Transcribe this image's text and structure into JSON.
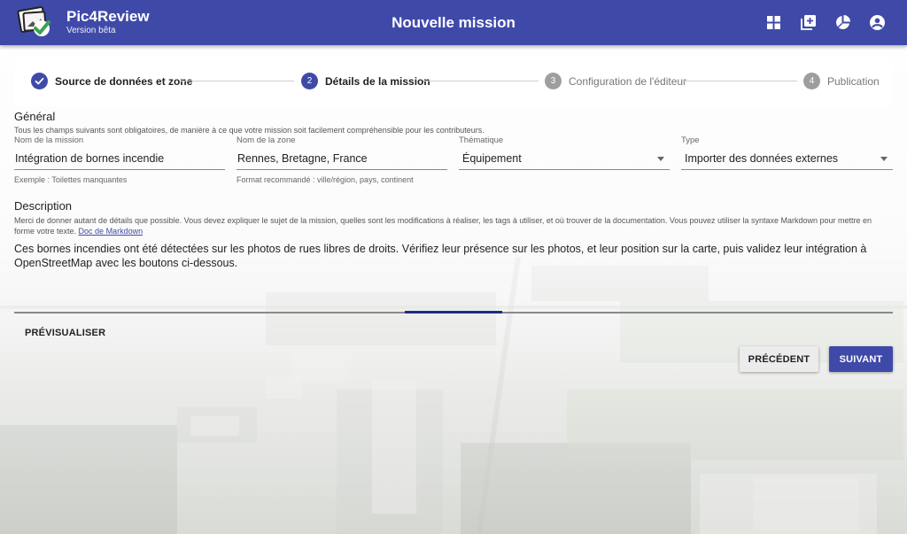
{
  "app": {
    "name": "Pic4Review",
    "version_label": "Version bêta",
    "page_title": "Nouvelle mission",
    "actions": [
      {
        "icon": "dashboard-icon"
      },
      {
        "icon": "add-box-icon"
      },
      {
        "icon": "pie-chart-icon"
      },
      {
        "icon": "account-circle-icon"
      }
    ],
    "colors": {
      "primary": "#3f4aa8",
      "accent": "#1f2a8a"
    }
  },
  "stepper": {
    "steps": [
      {
        "index": "✓",
        "label": "Source de données et zone",
        "state": "completed"
      },
      {
        "index": "2",
        "label": "Détails de la mission",
        "state": "active"
      },
      {
        "index": "3",
        "label": "Configuration de l'éditeur",
        "state": "idle"
      },
      {
        "index": "4",
        "label": "Publication",
        "state": "idle"
      }
    ]
  },
  "general": {
    "heading": "Général",
    "help": "Tous les champs suivants sont obligatoires, de manière à ce que votre mission soit facilement compréhensible pour les contributeurs.",
    "mission_name": {
      "label": "Nom de la mission",
      "value": "Intégration de bornes incendie",
      "hint": "Exemple : Toilettes manquantes"
    },
    "zone_name": {
      "label": "Nom de la zone",
      "value": "Rennes, Bretagne, France",
      "hint": "Format recommandé : ville/région, pays, continent"
    },
    "theme": {
      "label": "Thématique",
      "value": "Équipement"
    },
    "type": {
      "label": "Type",
      "value": "Importer des données externes"
    }
  },
  "description": {
    "heading": "Description",
    "help": "Merci de donner autant de détails que possible. Vous devez expliquer le sujet de la mission, quelles sont les modifications à réaliser, les tags à utiliser, et où trouver de la documentation. Vous pouvez utiliser la syntaxe Markdown pour mettre en forme votre texte.",
    "link": "Doc de Markdown",
    "text": "Ces bornes incendies ont été détectées sur les photos de rues libres de droits. Vérifiez leur présence sur les photos, et leur position sur la carte, puis validez leur intégration à OpenStreetMap avec les boutons ci-dessous."
  },
  "preview_label": "PRÉVISUALISER",
  "buttons": {
    "previous": "PRÉCÉDENT",
    "next": "SUIVANT"
  }
}
